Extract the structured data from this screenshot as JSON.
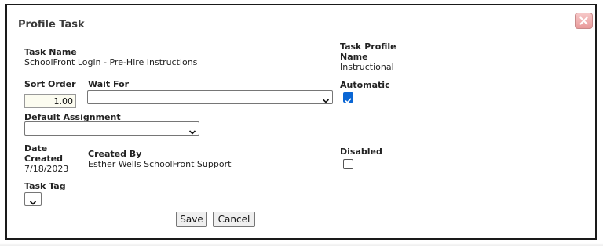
{
  "dialog": {
    "title": "Profile Task",
    "close_icon": "close-icon"
  },
  "fields": {
    "task_name_label": "Task Name",
    "task_name_value": "SchoolFront Login - Pre-Hire Instructions",
    "task_profile_name_label_1": "Task Profile",
    "task_profile_name_label_2": "Name",
    "task_profile_name_value": "Instructional",
    "sort_order_label": "Sort Order",
    "sort_order_value": "1.00",
    "wait_for_label": "Wait For",
    "wait_for_value": "",
    "automatic_label": "Automatic",
    "automatic_checked": true,
    "default_assignment_label": "Default Assignment",
    "default_assignment_value": "",
    "date_created_label_1": "Date",
    "date_created_label_2": "Created",
    "date_created_value": "7/18/2023",
    "created_by_label": "Created By",
    "created_by_value": "Esther Wells SchoolFront Support",
    "disabled_label": "Disabled",
    "disabled_checked": false,
    "task_tag_label": "Task Tag",
    "task_tag_value": ""
  },
  "buttons": {
    "save_label": "Save",
    "cancel_label": "Cancel"
  },
  "colors": {
    "checkbox_accent": "#0a66d4",
    "close_button": "#e99a9a"
  }
}
